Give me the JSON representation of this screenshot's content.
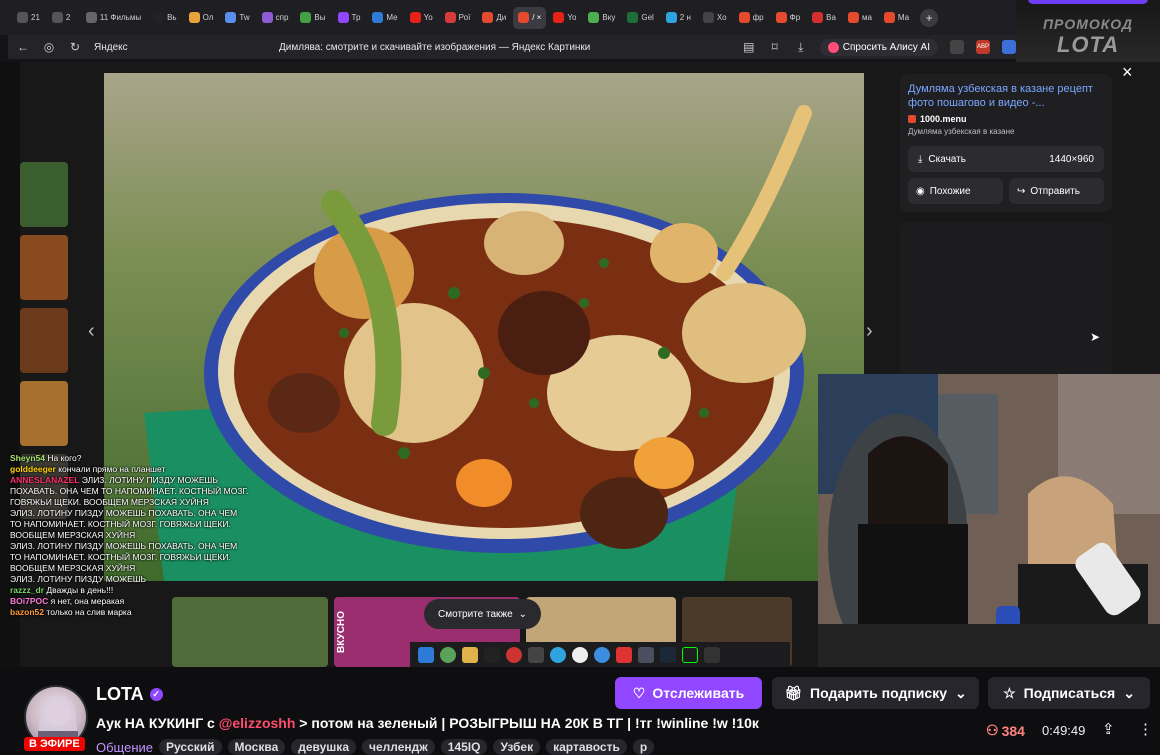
{
  "browser": {
    "tabs": [
      {
        "label": "21"
      },
      {
        "label": "2"
      },
      {
        "label": "11 Фильмы"
      },
      {
        "label": "Вь"
      },
      {
        "label": "Ол"
      },
      {
        "label": "Tw"
      },
      {
        "label": "спр"
      },
      {
        "label": "Вы"
      },
      {
        "label": "Тр"
      },
      {
        "label": "Ме"
      },
      {
        "label": "Yo"
      },
      {
        "label": "Рої"
      },
      {
        "label": "Ди"
      },
      {
        "label": "/ ×"
      },
      {
        "label": "Yo"
      },
      {
        "label": "Вку"
      },
      {
        "label": "Gel"
      },
      {
        "label": "2 н"
      },
      {
        "label": "Хо"
      },
      {
        "label": "фр"
      },
      {
        "label": "Фр"
      },
      {
        "label": "Ва"
      },
      {
        "label": "ма"
      },
      {
        "label": "Ма"
      }
    ],
    "domain": "Яндекс",
    "page_title": "Димлява: смотрите и скачивайте изображения — Яндекс Картинки",
    "ask_alice": "Спросить Алису AI",
    "ext_label": "ABP"
  },
  "promo": {
    "line1": "ПРОМОКОД",
    "line2": "LOTA"
  },
  "image_panel": {
    "source_title": "Думляма узбекская в казане рецепт фото пошагово и видео -...",
    "site": "1000.menu",
    "description": "Думляма узбекская в казане",
    "download": "Скачать",
    "size": "1440×960",
    "similar": "Похожие",
    "send": "Отправить",
    "see_also": "Смотрите также"
  },
  "thumb_text": "ВКУСНО",
  "chat": [
    {
      "user": "Sheyn54",
      "text": "На кого?",
      "color": "#a3e36b"
    },
    {
      "user": "golddeeger",
      "text": "кончали прямо на планшет",
      "color": "#ffd400"
    },
    {
      "user": "ANNESLANAZEL",
      "text": "ЭЛИЗ. ЛОТИНУ ПИЗДУ МОЖЕШЬ ПОХАВАТЬ. ОНА ЧЕМ ТО НАПОМИНАЕТ. КОСТНЫЙ МОЗГ. ГОВЯЖЬИ ЩЕКИ. ВООБЩЕМ МЕРЗСКАЯ ХУЙНЯ",
      "color": "#ff2d6f"
    },
    {
      "user": "",
      "text": "ЭЛИЗ. ЛОТИНУ ПИЗДУ МОЖЕШЬ ПОХАВАТЬ. ОНА ЧЕМ ТО НАПОМИНАЕТ. КОСТНЫЙ МОЗГ. ГОВЯЖЬИ ЩЕКИ. ВООБЩЕМ МЕРЗСКАЯ ХУЙНЯ",
      "color": "#ffffff"
    },
    {
      "user": "",
      "text": "ЭЛИЗ. ЛОТИНУ ПИЗДУ МОЖЕШЬ ПОХАВАТЬ. ОНА ЧЕМ ТО НАПОМИНАЕТ. КОСТНЫЙ МОЗГ. ГОВЯЖЬИ ЩЕКИ. ВООБЩЕМ МЕРЗСКАЯ ХУЙНЯ",
      "color": "#ffffff"
    },
    {
      "user": "",
      "text": "ЭЛИЗ. ЛОТИНУ ПИЗДУ МОЖЕШЬ",
      "color": "#ffffff"
    },
    {
      "user": "razzz_dr",
      "text": "Дважды в день!!!",
      "color": "#7cd66a"
    },
    {
      "user": "BOi7POC",
      "text": "я нет, она меракая",
      "color": "#ff7ad9"
    },
    {
      "user": "bazon52",
      "text": "только на слив марка",
      "color": "#ff9a3d"
    }
  ],
  "channel": {
    "name": "LOTA",
    "live_label": "В ЭФИРЕ",
    "title_prefix": "Аук НА КУКИНГ с ",
    "mention": "@elizzoshh",
    "title_suffix": " > потом на зеленый | РОЗЫГРЫШ НА 20К В ТГ | !тг !winline !w !10к",
    "category": "Общение",
    "tags": [
      "Русский",
      "Москва",
      "девушка",
      "челлендж",
      "145IQ",
      "Узбек",
      "картавость",
      "р"
    ],
    "follow": "Отслеживать",
    "gift": "Подарить подписку",
    "subscribe": "Подписаться",
    "viewers": "384",
    "uptime": "0:49:49"
  },
  "colors": {
    "twitch_purple": "#9147ff",
    "live_red": "#eb0400",
    "viewers_red": "#ff8280",
    "mention": "#ff4c6d"
  }
}
